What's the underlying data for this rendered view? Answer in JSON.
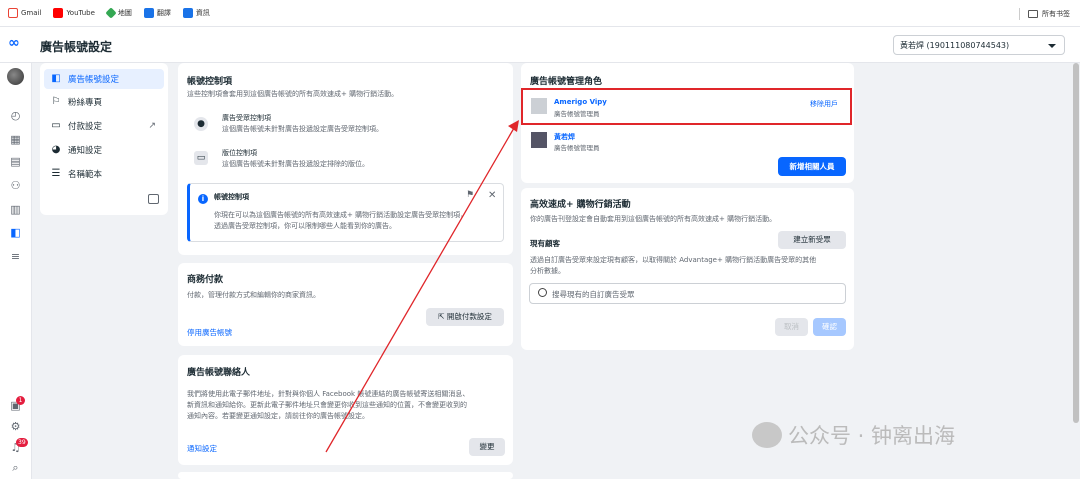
{
  "bookmarks": {
    "items": [
      {
        "label": "Gmail"
      },
      {
        "label": "YouTube"
      },
      {
        "label": "地圖"
      },
      {
        "label": "翻譯"
      },
      {
        "label": "資訊"
      }
    ],
    "all_bookmarks": "所有书签"
  },
  "header": {
    "title": "廣告帳號設定",
    "account": "黃若焊 (190111080744543)"
  },
  "nav": {
    "items": [
      {
        "label": "廣告帳號設定"
      },
      {
        "label": "粉絲專頁"
      },
      {
        "label": "付款設定"
      },
      {
        "label": "通知設定"
      },
      {
        "label": "名稱範本"
      }
    ]
  },
  "rail": {
    "badge1": "1",
    "badge2": "39"
  },
  "account_controls": {
    "title": "帳號控制項",
    "desc": "這些控制項會套用到這個廣告帳號的所有高效速成+ 購物行銷活動。",
    "items": [
      {
        "title": "廣告受眾控制項",
        "desc": "這個廣告帳號未針對廣告投遞設定廣告受眾控制項。"
      },
      {
        "title": "版位控制項",
        "desc": "這個廣告帳號未針對廣告投遞設定排除的版位。"
      }
    ],
    "info": {
      "title": "帳號控制項",
      "line1": "你現在可以為這個廣告帳號的所有高效速成+ 購物行銷活動設定廣告受眾控制項，",
      "line2": "透過廣告受眾控制項，你可以限制哪些人能看到你的廣告。"
    }
  },
  "business_payment": {
    "title": "商務付款",
    "desc": "付款，管理付款方式和編輯你的商家資訊。",
    "button": "開啟付款設定",
    "link": "停用廣告帳號"
  },
  "contact": {
    "title": "廣告帳號聯絡人",
    "line1": "我們將使用此電子郵件地址，針對與你個人 Facebook 帳號連結的廣告帳號寄送相關消息、",
    "line2": "新資訊和通知給你。更新此電子郵件地址只會變更你收到這些通知的位置，不會變更收到的",
    "line3": "通知內容。若要變更通知設定，請前往你的廣告帳號設定。",
    "link": "通知設定",
    "button": "變更"
  },
  "roles": {
    "title": "廣告帳號管理角色",
    "people": [
      {
        "name": "Amerigo Vipy",
        "role": "廣告帳號管理員",
        "action": "移除用戶"
      },
      {
        "name": "黃若焊",
        "role": "廣告帳號管理員"
      }
    ],
    "add_button": "新增相關人員"
  },
  "advantage": {
    "title": "高效速成+ 購物行銷活動",
    "desc": "你的廣告刊登設定會自動套用到這個廣告帳號的所有高效速成+ 購物行銷活動。",
    "existing_label": "現有顧客",
    "create_button": "建立新受眾",
    "help1": "透過自訂廣告受眾來設定現有顧客，以取得關於 Advantage+ 購物行銷活動廣告受眾的其他",
    "help2": "分析數據。",
    "search_placeholder": "搜尋現有的自訂廣告受眾",
    "cancel": "取消",
    "confirm": "確認"
  },
  "watermark": "公众号 · 钟离出海",
  "colors": {
    "accent": "#0866ff",
    "highlight": "#e0262a"
  }
}
